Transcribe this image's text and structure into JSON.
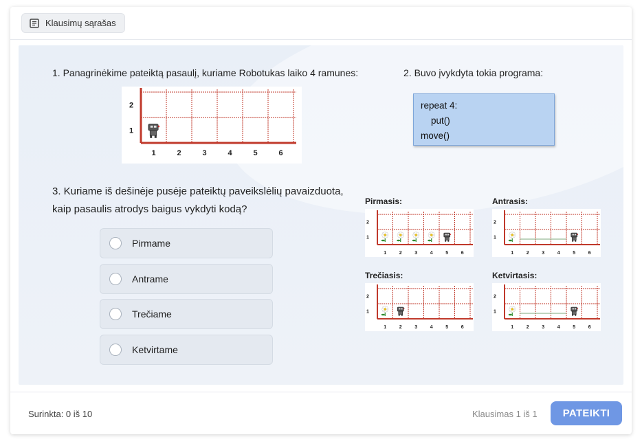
{
  "topbar": {
    "question_list_label": "Klausimų sąrašas",
    "icon": "list-icon"
  },
  "task": {
    "step1": "1. Panagrinėkime pateiktą pasaulį, kuriame Robotukas laiko 4 ramunes:",
    "step2": "2. Buvo įvykdyta tokia programa:",
    "code_lines": [
      "repeat 4:",
      "put()",
      "move()"
    ],
    "step3": "3. Kuriame iš dešinėje pusėje pateiktų paveikslėlių pavaizduota, kaip pasaulis atrodys baigus vykdyti kodą?",
    "world": {
      "row_labels": [
        "2",
        "1"
      ],
      "col_labels": [
        "1",
        "2",
        "3",
        "4",
        "5",
        "6"
      ]
    }
  },
  "options": [
    {
      "label": "Pirmame"
    },
    {
      "label": "Antrame"
    },
    {
      "label": "Trečiame"
    },
    {
      "label": "Ketvirtame"
    }
  ],
  "variants": [
    {
      "caption": "Pirmasis:",
      "flowers": [
        1,
        2,
        3,
        4
      ],
      "robot": 5
    },
    {
      "caption": "Antrasis:",
      "flowers": [
        1
      ],
      "robot": 5
    },
    {
      "caption": "Trečiasis:",
      "flowers": [
        1
      ],
      "robot": 2
    },
    {
      "caption": "Ketvirtasis:",
      "flowers": [
        1
      ],
      "robot": 5
    }
  ],
  "footer": {
    "score": "Surinkta: 0 iš 10",
    "question_counter": "Klausimas 1 iš 1",
    "submit_label": "PATEIKTI"
  },
  "colors": {
    "accent": "#6f97e4",
    "grid": "#c0392b",
    "code_bg": "#b9d3f2"
  }
}
